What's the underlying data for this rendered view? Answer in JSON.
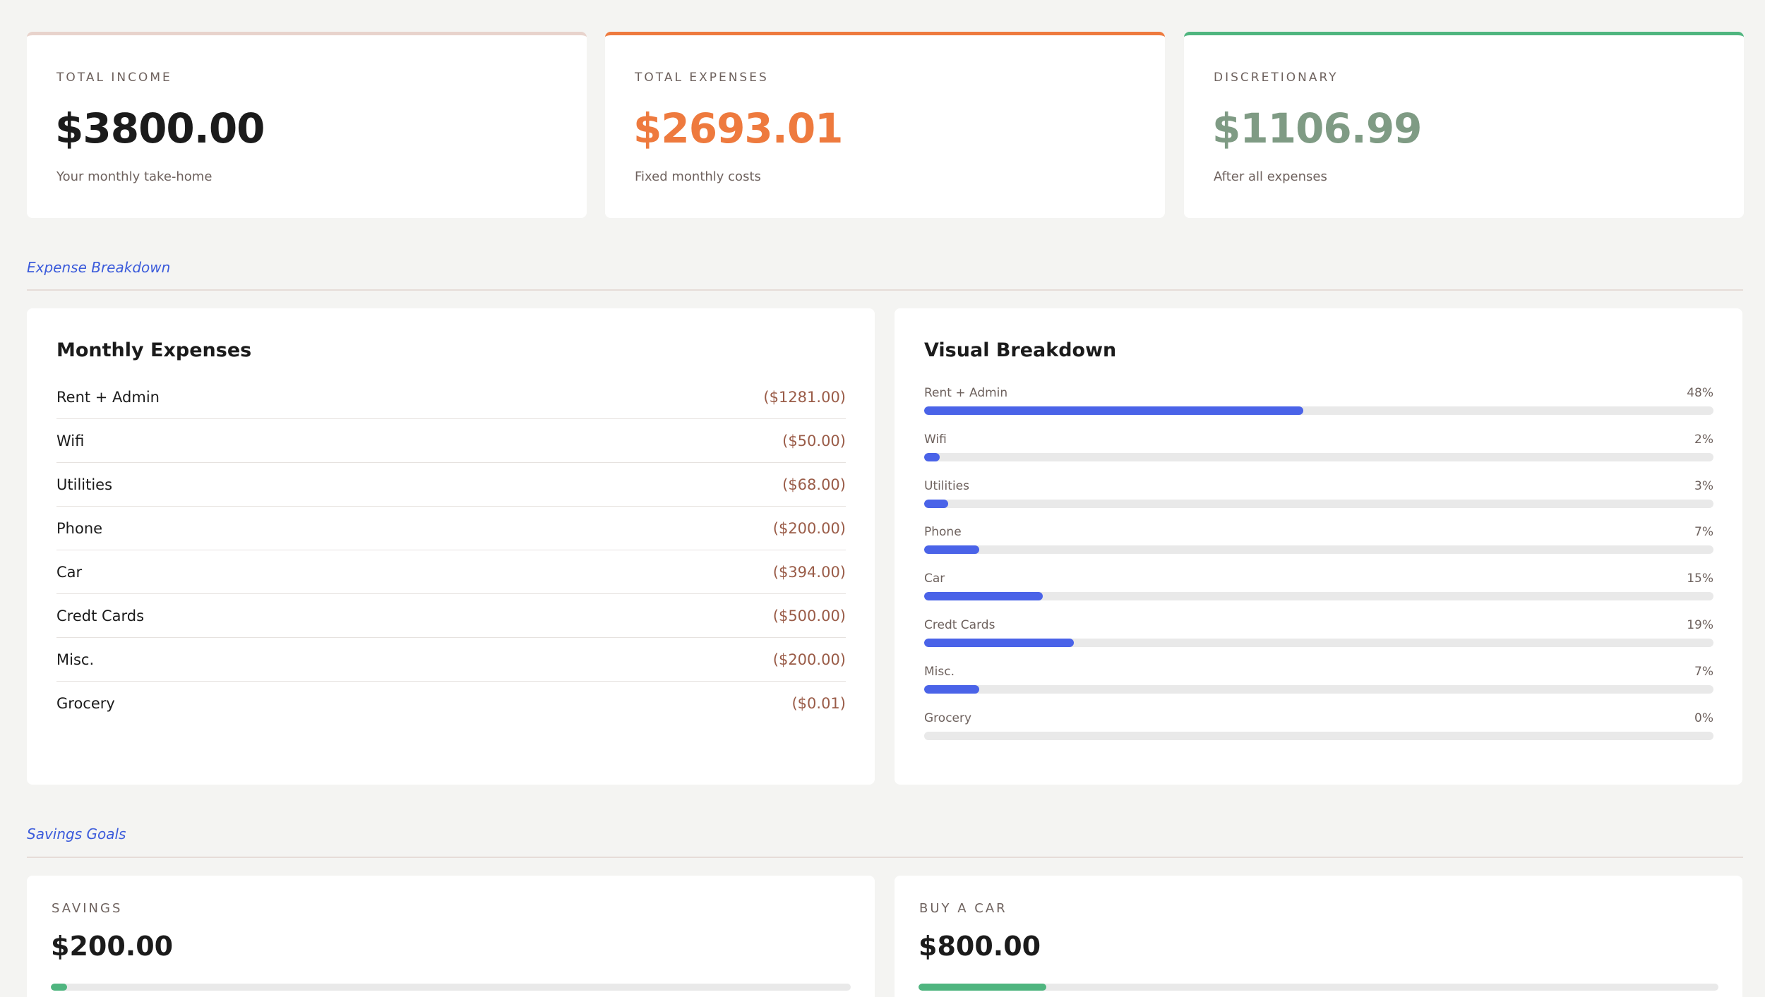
{
  "colors": {
    "accent": "#3b5bdb",
    "bar": "#4a63e8",
    "income_border": "#e8d3cc",
    "expenses_border": "#ee7a3e",
    "discretionary_border": "#4fb57f",
    "expenses_value": "#ee7a3e",
    "discretionary_value": "#7f9b84",
    "amount_text": "#9a5c48",
    "goal_fill": "#4fb57f"
  },
  "summary": {
    "income": {
      "label": "TOTAL INCOME",
      "value": "$3800.00",
      "sub": "Your monthly take-home"
    },
    "expenses": {
      "label": "TOTAL EXPENSES",
      "value": "$2693.01",
      "sub": "Fixed monthly costs"
    },
    "discretionary": {
      "label": "DISCRETIONARY",
      "value": "$1106.99",
      "sub": "After all expenses"
    }
  },
  "sections": {
    "expense_breakdown": "Expense Breakdown",
    "savings_goals": "Savings Goals"
  },
  "monthly_expenses": {
    "title": "Monthly Expenses",
    "rows": [
      {
        "name": "Rent + Admin",
        "amount": "($1281.00)"
      },
      {
        "name": "Wifi",
        "amount": "($50.00)"
      },
      {
        "name": "Utilities",
        "amount": "($68.00)"
      },
      {
        "name": "Phone",
        "amount": "($200.00)"
      },
      {
        "name": "Car",
        "amount": "($394.00)"
      },
      {
        "name": "Credt Cards",
        "amount": "($500.00)"
      },
      {
        "name": "Misc.",
        "amount": "($200.00)"
      },
      {
        "name": "Grocery",
        "amount": "($0.01)"
      }
    ]
  },
  "visual_breakdown": {
    "title": "Visual Breakdown",
    "bars": [
      {
        "name": "Rent + Admin",
        "pct_label": "48%",
        "pct": 48
      },
      {
        "name": "Wifi",
        "pct_label": "2%",
        "pct": 2
      },
      {
        "name": "Utilities",
        "pct_label": "3%",
        "pct": 3
      },
      {
        "name": "Phone",
        "pct_label": "7%",
        "pct": 7
      },
      {
        "name": "Car",
        "pct_label": "15%",
        "pct": 15
      },
      {
        "name": "Credt Cards",
        "pct_label": "19%",
        "pct": 19
      },
      {
        "name": "Misc.",
        "pct_label": "7%",
        "pct": 7
      },
      {
        "name": "Grocery",
        "pct_label": "0%",
        "pct": 0
      }
    ]
  },
  "goals": [
    {
      "label": "SAVINGS",
      "value": "$200.00",
      "progress": 2
    },
    {
      "label": "BUY A CAR",
      "value": "$800.00",
      "progress": 16
    }
  ]
}
